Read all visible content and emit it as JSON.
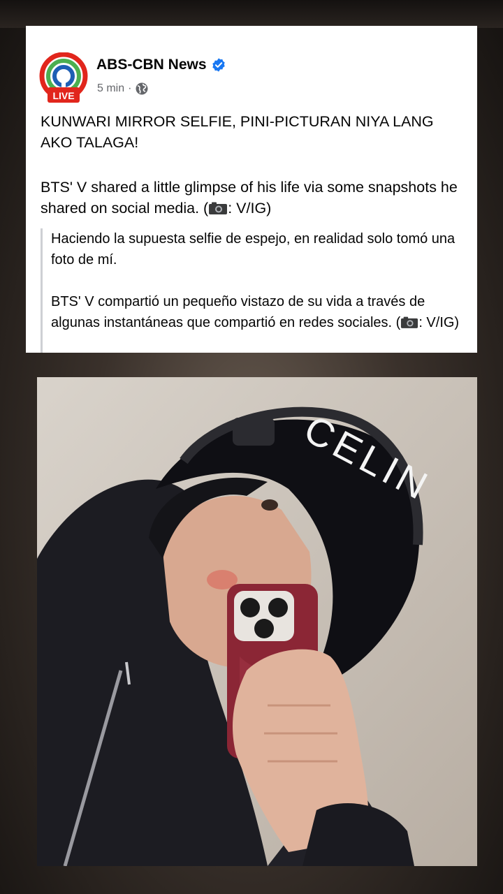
{
  "post": {
    "page_name": "ABS-CBN News",
    "time": "5 min",
    "separator": "·",
    "logo_badge": "LIVE",
    "headline": "KUNWARI MIRROR SELFIE, PINI-PICTURAN NIYA LANG AKO TALAGA!",
    "body_text": "BTS' V shared a little glimpse of his life via some snapshots he shared on social media. (",
    "body_credit": ": V/IG)",
    "translation_line1": "Haciendo la supuesta selfie de espejo, en realidad solo tomó una foto de mí.",
    "translation_line2": "BTS' V compartió un pequeño vistazo de su vida a través de algunas instantáneas que compartió en redes sociales. (",
    "translation_credit": ": V/IG)"
  },
  "photo": {
    "cap_text": "CELIN"
  },
  "colors": {
    "verified_blue": "#1877f2",
    "logo_red": "#e1261c",
    "logo_green": "#4caf50",
    "logo_blue": "#1e5fb4"
  },
  "icons": {
    "verified": "verified-badge-icon",
    "audience": "globe-icon",
    "camera": "camera-icon"
  }
}
